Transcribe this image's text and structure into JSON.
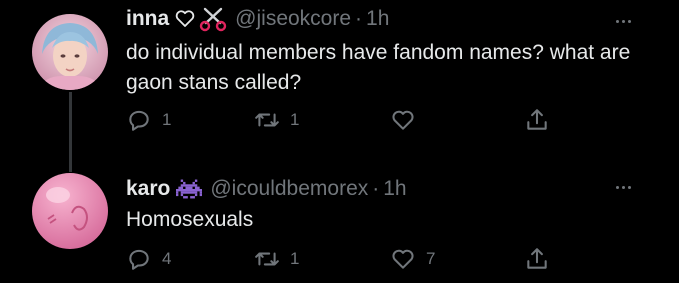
{
  "tweets": [
    {
      "display_name": "inna",
      "name_emojis": [
        "white-heart-icon",
        "scissors-icon"
      ],
      "handle": "@jiseokcore",
      "separator": "·",
      "time": "1h",
      "text": "do individual members have fandom names? what are gaon stans called?",
      "actions": {
        "reply": "1",
        "retweet": "1",
        "like": ""
      }
    },
    {
      "display_name": "karo",
      "name_emojis": [
        "space-invader-icon"
      ],
      "handle": "@icouldbemorex",
      "separator": "·",
      "time": "1h",
      "text": "Homosexuals",
      "actions": {
        "reply": "4",
        "retweet": "1",
        "like": "7"
      }
    }
  ],
  "colors": {
    "background": "#000000",
    "text": "#e7e9ea",
    "muted": "#71767b",
    "thread_line": "#333639"
  }
}
